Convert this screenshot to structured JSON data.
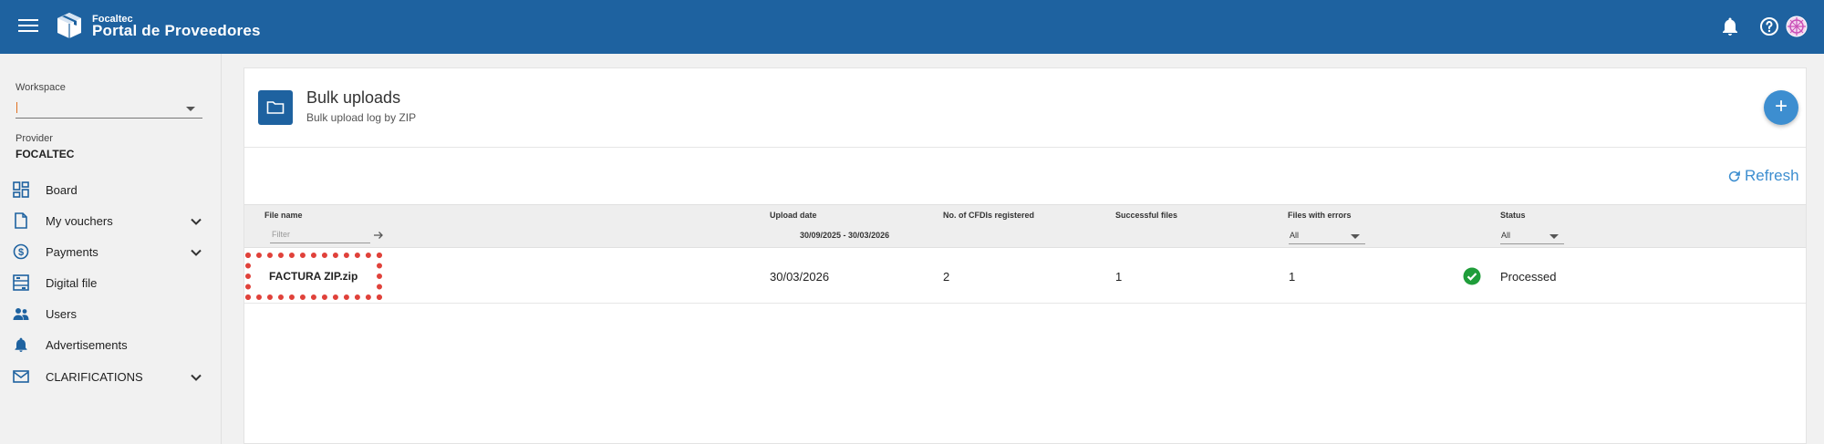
{
  "app": {
    "brand_small": "Focaltec",
    "brand_title": "Portal de Proveedores"
  },
  "sidebar": {
    "workspace_label": "Workspace",
    "workspace_value": "",
    "provider_label": "Provider",
    "provider_value": "FOCALTEC",
    "items": [
      {
        "label": "Board",
        "icon": "dashboard-icon",
        "expandable": false
      },
      {
        "label": "My vouchers",
        "icon": "document-icon",
        "expandable": true
      },
      {
        "label": "Payments",
        "icon": "dollar-icon",
        "expandable": true
      },
      {
        "label": "Digital file",
        "icon": "digital-file-icon",
        "expandable": false
      },
      {
        "label": "Users",
        "icon": "users-icon",
        "expandable": false
      },
      {
        "label": "Advertisements",
        "icon": "bell-icon",
        "expandable": false
      },
      {
        "label": "CLARIFICATIONS",
        "icon": "mail-icon",
        "expandable": true
      }
    ]
  },
  "page": {
    "title": "Bulk uploads",
    "subtitle": "Bulk upload log by ZIP",
    "refresh_label": "Refresh"
  },
  "table": {
    "columns": [
      "File name",
      "Upload date",
      "No. of CFDIs registered",
      "Successful files",
      "Files with errors",
      "Status"
    ],
    "filters": {
      "file_name_placeholder": "Filter",
      "date_range": "30/09/2025 - 30/03/2026",
      "files_with_errors": "All",
      "status": "All"
    },
    "rows": [
      {
        "file_name": "FACTURA ZIP.zip",
        "upload_date": "30/03/2026",
        "cfdis_registered": "2",
        "successful_files": "1",
        "files_with_errors": "1",
        "status": "Processed"
      }
    ]
  },
  "colors": {
    "topbar": "#1e62a0",
    "accent": "#3d8ed0",
    "success": "#1f9d3a",
    "highlight": "#e0413a"
  }
}
